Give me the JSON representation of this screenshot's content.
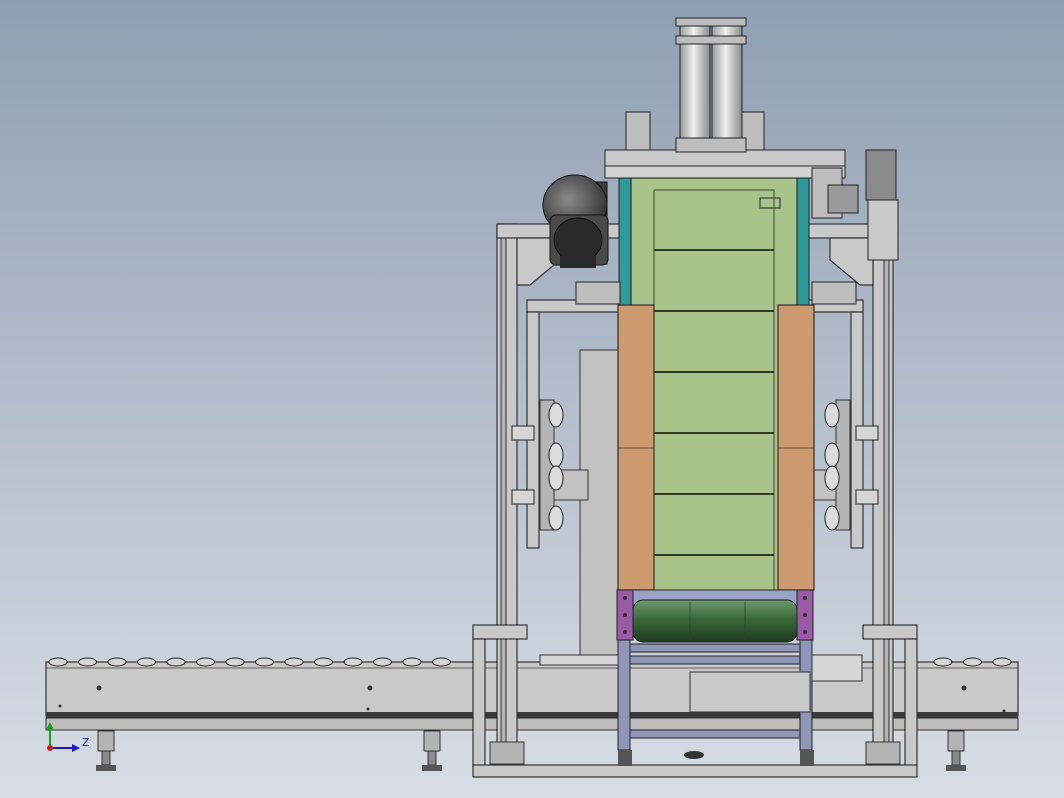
{
  "viewport": {
    "background_top": "#8f9fb3",
    "background_bottom": "#d7dde4"
  },
  "colors": {
    "frame": "#c9c9c9",
    "tube_body": "#a8c48a",
    "side_panels": "#cc9a6e",
    "drum": "#3f6e3f",
    "purple_brackets": "#9a5aa6",
    "teal_edges": "#2f9a9a",
    "motor": "#4a4a4a",
    "cylinders": "#d9d9d9"
  },
  "triad": {
    "icon": "coordinate-triad-icon",
    "axis_z_label": "Z",
    "colors": {
      "x": "#d41c1c",
      "y": "#16a016",
      "z": "#1a1acc"
    }
  }
}
